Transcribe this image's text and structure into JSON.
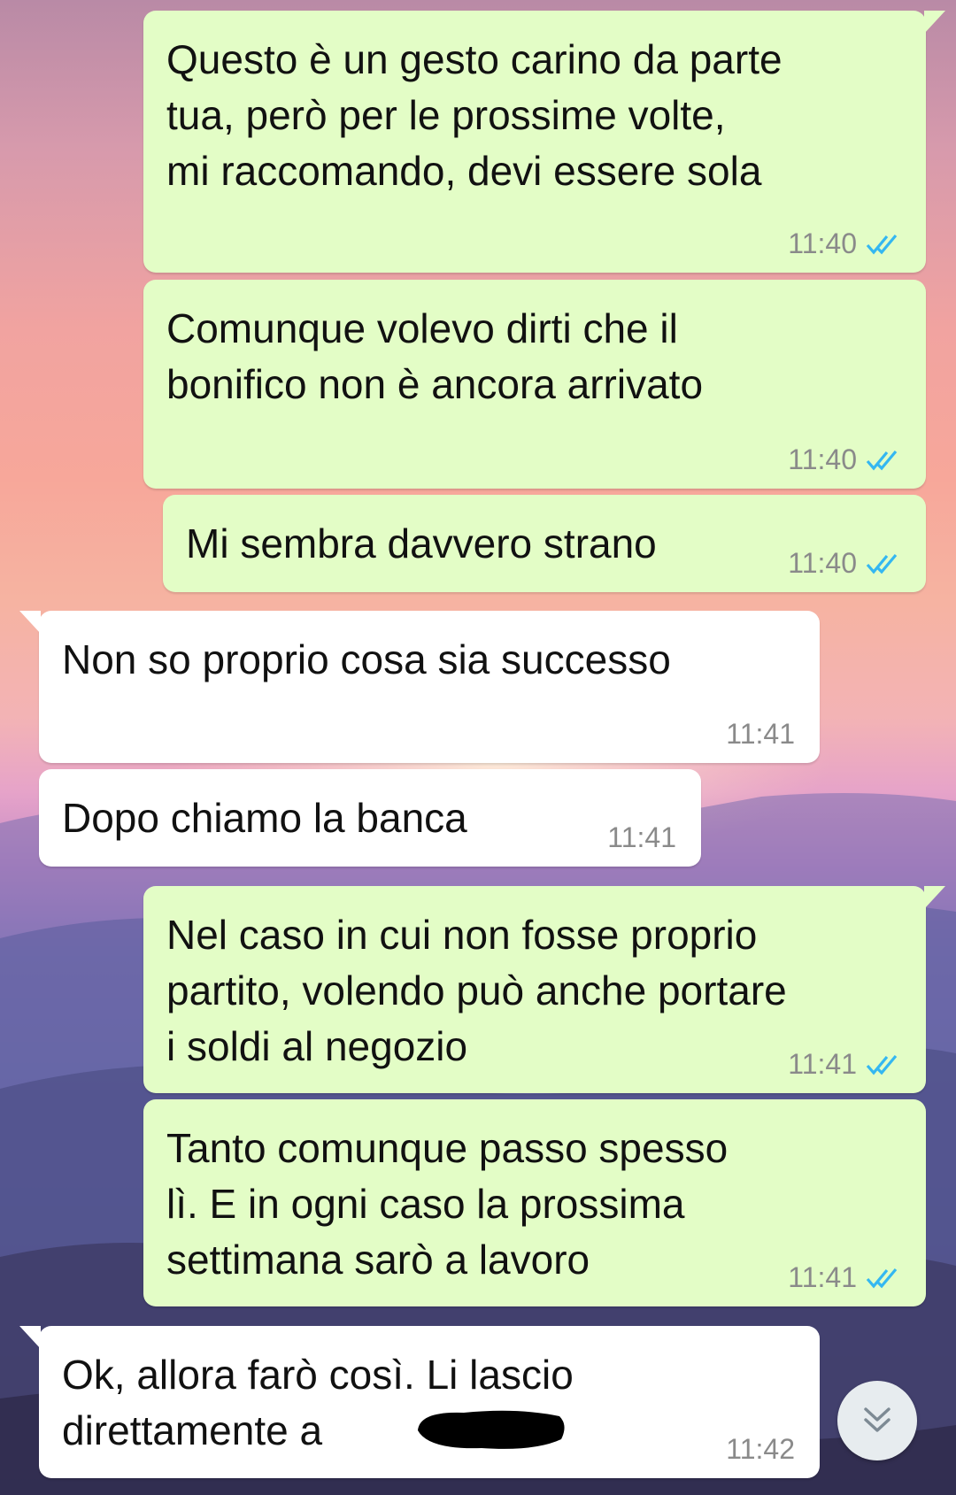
{
  "conversation": {
    "messages": [
      {
        "direction": "outgoing",
        "text": "Questo è un gesto carino da parte\ntua, però per le prossime volte,\nmi raccomando, devi essere sola",
        "time": "11:40",
        "read": true
      },
      {
        "direction": "outgoing",
        "text": "Comunque volevo dirti che il\nbonifico non è ancora arrivato",
        "time": "11:40",
        "read": true
      },
      {
        "direction": "outgoing",
        "text": "Mi sembra davvero strano",
        "time": "11:40",
        "read": true
      },
      {
        "direction": "incoming",
        "text": "Non so proprio cosa sia successo",
        "time": "11:41"
      },
      {
        "direction": "incoming",
        "text": "Dopo chiamo la banca",
        "time": "11:41"
      },
      {
        "direction": "outgoing",
        "text": "Nel caso in cui non fosse proprio\npartito, volendo può anche portare\ni soldi al negozio",
        "time": "11:41",
        "read": true
      },
      {
        "direction": "outgoing",
        "text": "Tanto comunque passo spesso\nlì. E in ogni caso la prossima\nsettimana sarò a lavoro",
        "time": "11:41",
        "read": true
      },
      {
        "direction": "incoming",
        "text": "Ok, allora farò così. Li lascio\ndirettamente a",
        "time": "11:42",
        "redacted_name": true
      }
    ]
  },
  "colors": {
    "outgoing_bubble": "#e3fdc6",
    "incoming_bubble": "#ffffff",
    "read_ticks": "#34b7f1",
    "timestamp": "#8a8a8a"
  },
  "icons": {
    "read_receipt": "double-check-icon",
    "scroll_down": "double-chevron-down-icon"
  }
}
